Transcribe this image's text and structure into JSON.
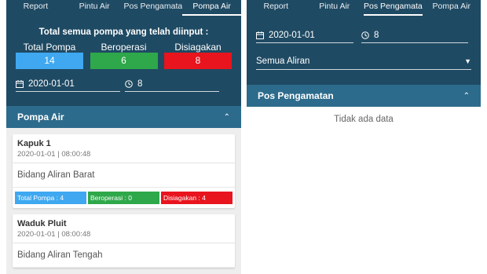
{
  "left": {
    "tabs": [
      "Report",
      "Pintu Air",
      "Pos Pengamatan",
      "Pompa Air"
    ],
    "summary_title": "Total semua pompa yang telah diinput :",
    "stats": {
      "total_label": "Total Pompa",
      "total_value": "14",
      "active_label": "Beroperasi",
      "active_value": "6",
      "standby_label": "Disiagakan",
      "standby_value": "8"
    },
    "date_value": "2020-01-01",
    "time_value": "8",
    "section_title": "Pompa Air",
    "cards": [
      {
        "name": "Kapuk 1",
        "datetime": "2020-01-01 | 08:00:48",
        "area": "Bidang Aliran Barat",
        "chip_total": "Total Pompa : 4",
        "chip_active": "Beroperasi : 0",
        "chip_standby": "Disiagakan : 4"
      },
      {
        "name": "Waduk Pluit",
        "datetime": "2020-01-01 | 08:00:48",
        "area": "Bidang Aliran Tengah"
      }
    ]
  },
  "right": {
    "tabs": [
      "Report",
      "Pintu Air",
      "Pos Pengamatan",
      "Pompa Air"
    ],
    "date_value": "2020-01-01",
    "time_value": "8",
    "select_value": "Semua Aliran",
    "section_title": "Pos Pengamatan",
    "empty_text": "Tidak ada data"
  },
  "colors": {
    "header": "#1f4a63",
    "section": "#2d6b8c",
    "blue": "#3fa8f0",
    "green": "#2ea84a",
    "red": "#e8141e"
  }
}
